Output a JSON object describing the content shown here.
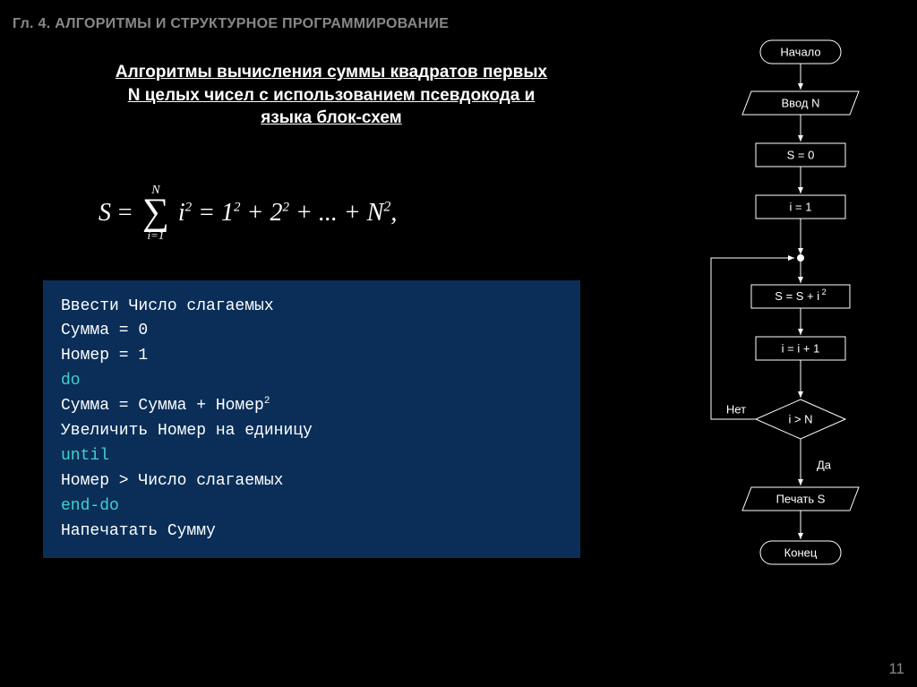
{
  "chapter": "Гл. 4. АЛГОРИТМЫ И СТРУКТУРНОЕ ПРОГРАММИРОВАНИЕ",
  "title_l1": "Алгоритмы вычисления суммы квадратов первых",
  "title_l2": "N целых чисел с использованием псевдокода и",
  "title_l3": "языка блок-схем",
  "formula": {
    "S": "S",
    "eq": "=",
    "N": "N",
    "i1": "i=1",
    "i2": "i",
    "rhs": " = 1",
    "plus": " + 2",
    "dots": " + ... + N",
    "comma": ","
  },
  "pseudo": {
    "l1": "Ввести Число слагаемых",
    "l2": "Сумма = 0",
    "l3": "Номер = 1",
    "l4": "do",
    "l5a": "   Сумма = Сумма + Номер",
    "l6": "   Увеличить Номер на единицу",
    "l7": "until",
    "l8": "   Номер > Число слагаемых",
    "l9": "end-do",
    "l10": "Напечатать Сумму"
  },
  "flow": {
    "start": "Начало",
    "input": "Ввод N",
    "s0": "S = 0",
    "i1": "i = 1",
    "ssi": "S = S + i",
    "ii": "i = i + 1",
    "cond": "i > N",
    "no": "Нет",
    "yes": "Да",
    "print": "Печать S",
    "end": "Конец"
  },
  "page": "11"
}
